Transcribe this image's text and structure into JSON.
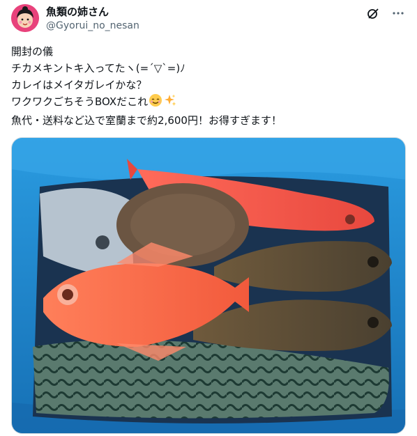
{
  "post": {
    "display_name": "魚類の姉さん",
    "handle": "@Gyorui_no_nesan",
    "lines": [
      "開封の儀",
      "チカメキントキ入ってたヽ(=´▽`=)ﾉ",
      "カレイはメイタガレイかな？",
      "ワクワクごちそうBOXだこれ",
      "魚代・送料など込で室蘭まで約2,600円！お得すぎます！"
    ],
    "emojis": [
      "smiling-face-icon",
      "sparkles-icon"
    ]
  },
  "header_icons": [
    "grok-icon",
    "more-icon"
  ],
  "media": {
    "description_icon": "fish-box-photo"
  },
  "colors": {
    "text": "#0f1419",
    "secondary": "#536471",
    "avatar_bg": "#e8427b",
    "box_blue": "#1e8fd4"
  }
}
